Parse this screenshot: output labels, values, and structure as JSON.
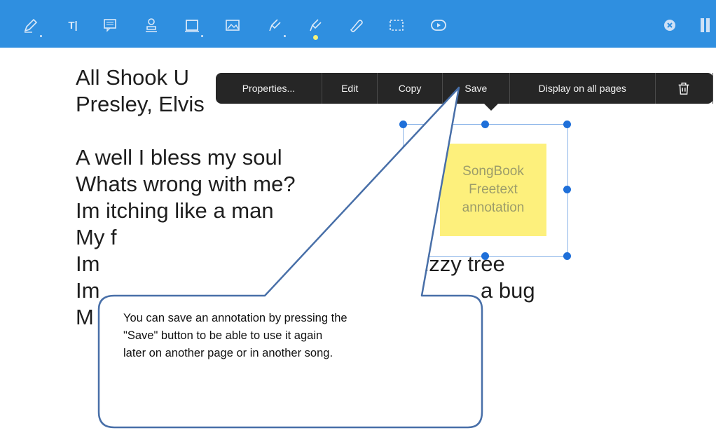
{
  "toolbar": {
    "tools": [
      {
        "icon": "pen-icon"
      },
      {
        "icon": "text-icon",
        "label": "T|"
      },
      {
        "icon": "note-icon"
      },
      {
        "icon": "stamp-icon"
      },
      {
        "icon": "rectangle-icon"
      },
      {
        "icon": "image-icon"
      },
      {
        "icon": "highlighter-icon"
      },
      {
        "icon": "marker-icon"
      },
      {
        "icon": "eraser-icon"
      },
      {
        "icon": "selection-icon"
      },
      {
        "icon": "play-icon"
      }
    ],
    "right_icons": [
      "close-icon",
      "panel-icon"
    ],
    "accent": "#2f8fe0"
  },
  "lyrics": {
    "lines": [
      "All Shook U",
      "Presley, Elvis",
      "",
      "A well I bless my soul",
      "Whats wrong with me?",
      "Im itching like a man",
      "My f",
      "Im",
      "Im",
      "M"
    ],
    "line_fragments": {
      "line6_tail": "uzzy tree",
      "line7_tail": "a bug"
    }
  },
  "context_menu": {
    "items": [
      "Properties...",
      "Edit",
      "Copy",
      "Save",
      "Display on all pages"
    ],
    "trash_icon": "trash-icon"
  },
  "annotation": {
    "lines": [
      "SongBook",
      "Freetext",
      "annotation"
    ],
    "color": "#fdf07c"
  },
  "callout": {
    "lines": [
      "You can save an annotation by pressing the",
      "\"Save\" button to be able to use it again",
      "later on another page or in another song."
    ]
  }
}
